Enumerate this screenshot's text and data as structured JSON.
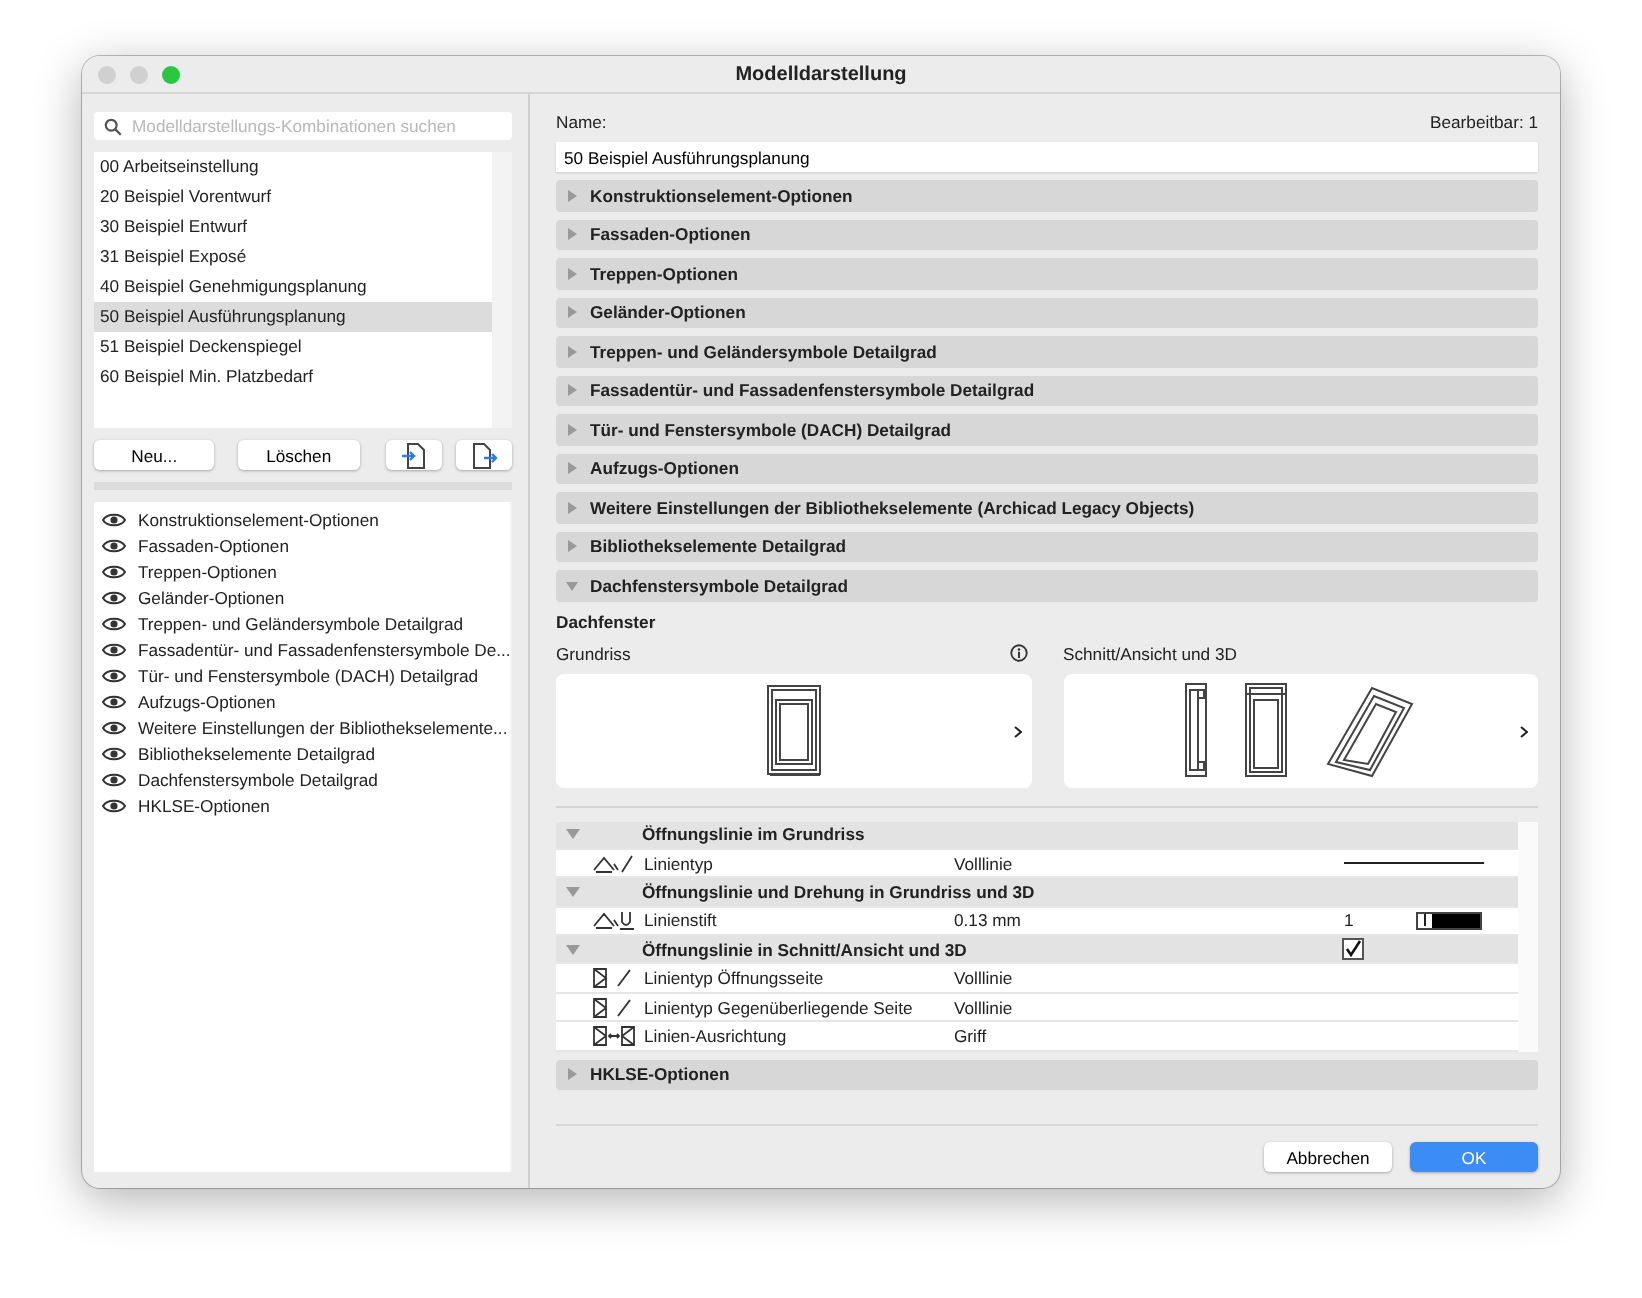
{
  "window": {
    "title": "Modelldarstellung"
  },
  "search": {
    "placeholder": "Modelldarstellungs-Kombinationen suchen"
  },
  "combinations": [
    {
      "label": "00 Arbeitseinstellung",
      "selected": false
    },
    {
      "label": "20 Beispiel Vorentwurf",
      "selected": false
    },
    {
      "label": "30 Beispiel Entwurf",
      "selected": false
    },
    {
      "label": "31 Beispiel Exposé",
      "selected": false
    },
    {
      "label": "40 Beispiel Genehmigungsplanung",
      "selected": false
    },
    {
      "label": "50 Beispiel Ausführungsplanung",
      "selected": true
    },
    {
      "label": "51 Beispiel Deckenspiegel",
      "selected": false
    },
    {
      "label": "60 Beispiel Min. Platzbedarf",
      "selected": false
    }
  ],
  "list_buttons": [
    {
      "kind": "text",
      "label": "Neu..."
    },
    {
      "kind": "text",
      "label": "Löschen"
    },
    {
      "kind": "import"
    },
    {
      "kind": "export"
    }
  ],
  "option_sets": [
    {
      "label": "Konstruktionselement-Optionen",
      "visible": true
    },
    {
      "label": "Fassaden-Optionen",
      "visible": true
    },
    {
      "label": "Treppen-Optionen",
      "visible": true
    },
    {
      "label": "Geländer-Optionen",
      "visible": true
    },
    {
      "label": "Treppen- und Geländersymbole Detailgrad",
      "visible": true
    },
    {
      "label": "Fassadentür- und Fassadenfenstersymbole De...",
      "visible": true
    },
    {
      "label": "Tür- und Fenstersymbole (DACH) Detailgrad",
      "visible": true
    },
    {
      "label": "Aufzugs-Optionen",
      "visible": true
    },
    {
      "label": "Weitere Einstellungen der Bibliothekselemente...",
      "visible": true
    },
    {
      "label": "Bibliothekselemente Detailgrad",
      "visible": true
    },
    {
      "label": "Dachfenstersymbole Detailgrad",
      "visible": true
    },
    {
      "label": "HKLSE-Optionen",
      "visible": true
    }
  ],
  "name_label": "Name:",
  "editable": "Bearbeitbar: 1",
  "name_value": "50 Beispiel Ausführungsplanung",
  "sections": [
    {
      "title": "Konstruktionselement-Optionen",
      "expanded": false
    },
    {
      "title": "Fassaden-Optionen",
      "expanded": false
    },
    {
      "title": "Treppen-Optionen",
      "expanded": false
    },
    {
      "title": "Geländer-Optionen",
      "expanded": false
    },
    {
      "title": "Treppen- und Geländersymbole Detailgrad",
      "expanded": false
    },
    {
      "title": "Fassadentür- und Fassadenfenstersymbole Detailgrad",
      "expanded": false
    },
    {
      "title": "Tür- und Fenstersymbole (DACH) Detailgrad",
      "expanded": false
    },
    {
      "title": "Aufzugs-Optionen",
      "expanded": false
    },
    {
      "title": "Weitere Einstellungen der Bibliothekselemente (Archicad Legacy Objects)",
      "expanded": false
    },
    {
      "title": "Bibliothekselemente Detailgrad",
      "expanded": false
    },
    {
      "title": "Dachfenstersymbole Detailgrad",
      "expanded": true,
      "content": {
        "heading": "Dachfenster",
        "plan_label": "Grundriss",
        "section_label": "Schnitt/Ansicht und 3D",
        "rows": [
          {
            "kind": "group",
            "title": "Öffnungslinie im Grundriss",
            "expanded": true
          },
          {
            "kind": "plan-line",
            "label": "Linientyp",
            "value": "Volllinie"
          },
          {
            "kind": "group",
            "title": "Öffnungslinie und Drehung in Grundriss und 3D",
            "expanded": true
          },
          {
            "kind": "plan-pen",
            "label": "Linienstift",
            "value": "0.13 mm",
            "pen": "1"
          },
          {
            "kind": "group",
            "title": "Öffnungslinie in Schnitt/Ansicht und 3D",
            "expanded": true,
            "checked": true
          },
          {
            "kind": "section-line",
            "label": "Linientyp Öffnungsseite",
            "value": "Volllinie"
          },
          {
            "kind": "section-line",
            "label": "Linientyp Gegenüberliegende Seite",
            "value": "Volllinie"
          },
          {
            "kind": "section-align",
            "label": "Linien-Ausrichtung",
            "value": "Griff"
          }
        ]
      }
    },
    {
      "title": "HKLSE-Optionen",
      "expanded": false
    }
  ],
  "buttons": [
    {
      "label": "Abbrechen",
      "primary": false
    },
    {
      "label": "OK",
      "primary": true
    }
  ]
}
